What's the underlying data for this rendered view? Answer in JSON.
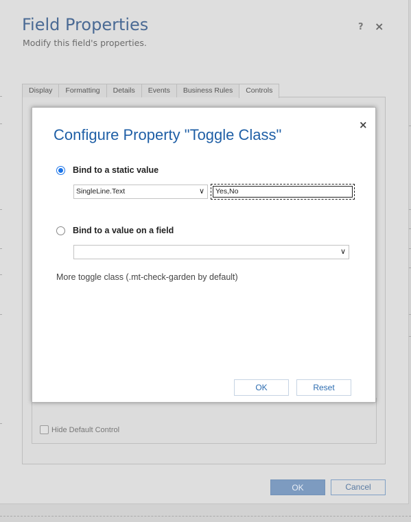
{
  "outer_dialog": {
    "title": "Field Properties",
    "subtitle": "Modify this field's properties.",
    "help_glyph": "?",
    "close_glyph": "×",
    "tabs": [
      {
        "label": "Display"
      },
      {
        "label": "Formatting"
      },
      {
        "label": "Details"
      },
      {
        "label": "Events"
      },
      {
        "label": "Business Rules"
      },
      {
        "label": "Controls"
      }
    ],
    "active_tab": "Controls",
    "hide_default_control_label": "Hide Default Control",
    "hide_default_control_checked": false,
    "ok_label": "OK",
    "cancel_label": "Cancel"
  },
  "modal": {
    "title": "Configure Property \"Toggle Class\"",
    "close_glyph": "×",
    "bind_static_label": "Bind to a static value",
    "bind_static_selected": true,
    "type_select_value": "SingleLine.Text",
    "static_value": "Yes,No",
    "bind_field_label": "Bind to a value on a field",
    "bind_field_selected": false,
    "field_select_value": "",
    "description": "More toggle class (.mt-check-garden by default)",
    "ok_label": "OK",
    "reset_label": "Reset"
  },
  "colors": {
    "accent": "#1f5fa6",
    "radio_selected": "#1a73e8",
    "outer_ok_bg": "#7d9bc0"
  }
}
